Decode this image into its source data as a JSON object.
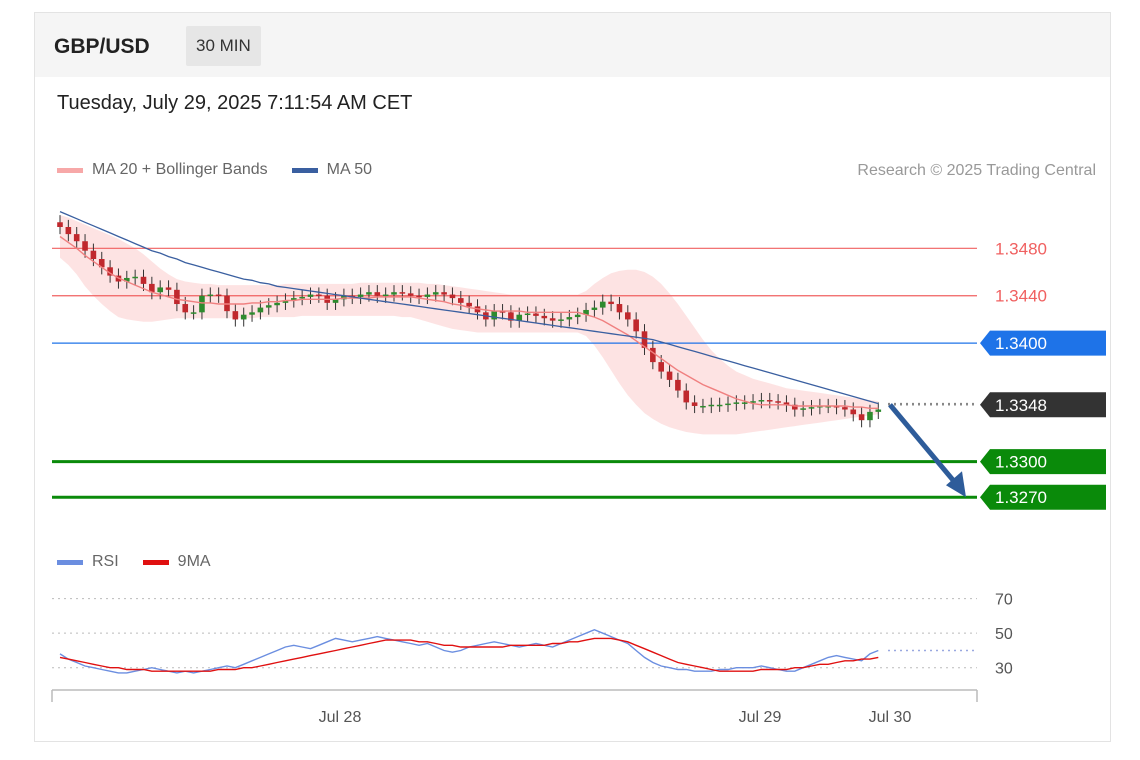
{
  "header": {
    "symbol": "GBP/USD",
    "timeframe": "30 MIN"
  },
  "datetime": "Tuesday, July 29, 2025 7:11:54 AM CET",
  "copyright": "Research © 2025 Trading Central",
  "legend_main": [
    {
      "label": "MA 20 + Bollinger Bands",
      "color": "#f08080"
    },
    {
      "label": "MA 50",
      "color": "#3a5fa0"
    }
  ],
  "legend_rsi": [
    {
      "label": "RSI",
      "color": "#6b8ee0"
    },
    {
      "label": "9MA",
      "color": "#e01010"
    }
  ],
  "colors": {
    "up_candle": "#2e8b2e",
    "down_candle": "#c0282d",
    "resistance": "#f06060",
    "pivot": "#1e73e8",
    "support": "#0a8a0a",
    "current": "#333333",
    "band_fill": "#fcdcdc",
    "arrow": "#2e5c9a",
    "ma50": "#3a5fa0",
    "ma20": "#f08080"
  },
  "chart_data": [
    {
      "type": "candlestick",
      "title": "GBP/USD 30 MIN",
      "x_tick_labels": [
        "Jul 28",
        "Jul 29",
        "Jul 30"
      ],
      "ylim": [
        1.3255,
        1.3525
      ],
      "levels": [
        {
          "value": 1.348,
          "label": "1.3480",
          "kind": "resistance"
        },
        {
          "value": 1.344,
          "label": "1.3440",
          "kind": "resistance"
        },
        {
          "value": 1.34,
          "label": "1.3400",
          "kind": "pivot"
        },
        {
          "value": 1.3348,
          "label": "1.3348",
          "kind": "current"
        },
        {
          "value": 1.33,
          "label": "1.3300",
          "kind": "support"
        },
        {
          "value": 1.327,
          "label": "1.3270",
          "kind": "support"
        }
      ],
      "close": [
        1.3498,
        1.3492,
        1.3486,
        1.3478,
        1.3471,
        1.3464,
        1.3457,
        1.3452,
        1.3455,
        1.3456,
        1.345,
        1.3443,
        1.3447,
        1.3445,
        1.3433,
        1.3426,
        1.3426,
        1.344,
        1.3441,
        1.344,
        1.3427,
        1.342,
        1.3424,
        1.3426,
        1.343,
        1.3432,
        1.3434,
        1.3436,
        1.3438,
        1.3439,
        1.3441,
        1.344,
        1.3434,
        1.3437,
        1.344,
        1.3439,
        1.3441,
        1.3443,
        1.344,
        1.3441,
        1.3443,
        1.3442,
        1.344,
        1.3439,
        1.3441,
        1.3443,
        1.3441,
        1.3438,
        1.3434,
        1.3431,
        1.3426,
        1.342,
        1.3427,
        1.3426,
        1.3419,
        1.3424,
        1.3425,
        1.3423,
        1.3421,
        1.3419,
        1.342,
        1.3422,
        1.3424,
        1.3428,
        1.343,
        1.3435,
        1.3433,
        1.3426,
        1.342,
        1.341,
        1.3396,
        1.3384,
        1.3376,
        1.3369,
        1.336,
        1.335,
        1.3347,
        1.3347,
        1.3348,
        1.3348,
        1.3349,
        1.335,
        1.335,
        1.3351,
        1.3352,
        1.3351,
        1.335,
        1.3348,
        1.3344,
        1.3345,
        1.3346,
        1.3347,
        1.3347,
        1.3346,
        1.3344,
        1.334,
        1.3335,
        1.3342,
        1.3344
      ],
      "ma20": [
        1.349,
        1.3485,
        1.348,
        1.3474,
        1.3469,
        1.3464,
        1.3459,
        1.3455,
        1.3452,
        1.3449,
        1.3446,
        1.3443,
        1.3441,
        1.3439,
        1.3437,
        1.3436,
        1.3435,
        1.3434,
        1.3434,
        1.3433,
        1.3433,
        1.3433,
        1.3433,
        1.3434,
        1.3434,
        1.3435,
        1.3435,
        1.3436,
        1.3436,
        1.3437,
        1.3437,
        1.3437,
        1.3437,
        1.3437,
        1.3438,
        1.3438,
        1.3438,
        1.3438,
        1.3439,
        1.3439,
        1.3439,
        1.3439,
        1.3439,
        1.3438,
        1.3437,
        1.3436,
        1.3435,
        1.3433,
        1.3432,
        1.343,
        1.3429,
        1.3428,
        1.3427,
        1.3427,
        1.3427,
        1.3427,
        1.3426,
        1.3426,
        1.3426,
        1.3426,
        1.3426,
        1.3426,
        1.3426,
        1.3424,
        1.3422,
        1.3419,
        1.3415,
        1.3411,
        1.3407,
        1.3402,
        1.3397,
        1.3392,
        1.3387,
        1.3382,
        1.3377,
        1.3373,
        1.3369,
        1.3365,
        1.3362,
        1.3359,
        1.3356,
        1.3353,
        1.3351,
        1.3349,
        1.3348,
        1.3348,
        1.3348,
        1.3348,
        1.3347,
        1.3347,
        1.3347,
        1.3347,
        1.3347,
        1.3347,
        1.3347,
        1.3346,
        1.3346,
        1.3345,
        1.3345
      ],
      "ma50": [
        1.3511,
        1.3508,
        1.3505,
        1.3502,
        1.3499,
        1.3496,
        1.3493,
        1.349,
        1.3487,
        1.3484,
        1.3481,
        1.3478,
        1.3476,
        1.3473,
        1.3471,
        1.3468,
        1.3466,
        1.3464,
        1.3462,
        1.346,
        1.3458,
        1.3456,
        1.3454,
        1.3453,
        1.3451,
        1.345,
        1.3448,
        1.3447,
        1.3446,
        1.3445,
        1.3444,
        1.3443,
        1.3442,
        1.3441,
        1.344,
        1.3439,
        1.3438,
        1.3437,
        1.3436,
        1.3435,
        1.3434,
        1.3433,
        1.3432,
        1.3431,
        1.343,
        1.3429,
        1.3428,
        1.3427,
        1.3426,
        1.3425,
        1.3424,
        1.3423,
        1.3422,
        1.3421,
        1.342,
        1.3419,
        1.3418,
        1.3417,
        1.3416,
        1.3415,
        1.3414,
        1.3413,
        1.3412,
        1.3411,
        1.341,
        1.3409,
        1.3408,
        1.3407,
        1.3406,
        1.3405,
        1.3404,
        1.3403,
        1.3401,
        1.3399,
        1.3397,
        1.3395,
        1.3393,
        1.3391,
        1.3389,
        1.3387,
        1.3385,
        1.3383,
        1.3381,
        1.3379,
        1.3377,
        1.3375,
        1.3373,
        1.3371,
        1.3369,
        1.3367,
        1.3365,
        1.3363,
        1.3361,
        1.3359,
        1.3357,
        1.3355,
        1.3353,
        1.3351,
        1.3349
      ],
      "bb_upper": [
        1.3508,
        1.3506,
        1.3503,
        1.35,
        1.3497,
        1.3494,
        1.3491,
        1.3488,
        1.3484,
        1.348,
        1.3475,
        1.3469,
        1.3463,
        1.3458,
        1.3454,
        1.3452,
        1.3451,
        1.345,
        1.345,
        1.3449,
        1.3449,
        1.3449,
        1.3449,
        1.3449,
        1.3449,
        1.3449,
        1.3449,
        1.345,
        1.345,
        1.345,
        1.345,
        1.345,
        1.345,
        1.345,
        1.345,
        1.345,
        1.3451,
        1.3451,
        1.3451,
        1.3451,
        1.3451,
        1.3451,
        1.3451,
        1.3451,
        1.345,
        1.345,
        1.3449,
        1.3448,
        1.3447,
        1.3446,
        1.3445,
        1.3444,
        1.3443,
        1.3442,
        1.3441,
        1.3441,
        1.3441,
        1.3441,
        1.3441,
        1.3441,
        1.3441,
        1.3441,
        1.3441,
        1.3444,
        1.345,
        1.3455,
        1.3459,
        1.3461,
        1.3462,
        1.3462,
        1.346,
        1.3456,
        1.345,
        1.3442,
        1.3433,
        1.3423,
        1.3413,
        1.3403,
        1.3394,
        1.3387,
        1.3381,
        1.3376,
        1.3373,
        1.337,
        1.3368,
        1.3366,
        1.3364,
        1.3362,
        1.3361,
        1.336,
        1.3359,
        1.3358,
        1.3357,
        1.3356,
        1.3355,
        1.3354,
        1.3353,
        1.3352,
        1.3351
      ],
      "bb_lower": [
        1.3472,
        1.3466,
        1.3458,
        1.3448,
        1.344,
        1.3433,
        1.3427,
        1.3422,
        1.342,
        1.3419,
        1.3418,
        1.3418,
        1.3419,
        1.342,
        1.3421,
        1.3421,
        1.3421,
        1.3421,
        1.3421,
        1.3421,
        1.3421,
        1.3421,
        1.3421,
        1.3421,
        1.3422,
        1.3422,
        1.3422,
        1.3422,
        1.3422,
        1.3423,
        1.3423,
        1.3423,
        1.3423,
        1.3423,
        1.3423,
        1.3423,
        1.3423,
        1.3423,
        1.3423,
        1.3423,
        1.3423,
        1.3422,
        1.3422,
        1.342,
        1.3418,
        1.3416,
        1.3414,
        1.3412,
        1.3411,
        1.341,
        1.3409,
        1.3409,
        1.3409,
        1.3409,
        1.3409,
        1.3409,
        1.3409,
        1.3409,
        1.3409,
        1.3409,
        1.3409,
        1.3409,
        1.3409,
        1.3406,
        1.3398,
        1.3388,
        1.3377,
        1.3366,
        1.3356,
        1.3348,
        1.3341,
        1.3336,
        1.3332,
        1.3329,
        1.3327,
        1.3325,
        1.3324,
        1.3323,
        1.3323,
        1.3323,
        1.3323,
        1.3323,
        1.3324,
        1.3325,
        1.3326,
        1.3327,
        1.3328,
        1.3329,
        1.333,
        1.3331,
        1.3332,
        1.3333,
        1.3334,
        1.3335,
        1.3336,
        1.3337,
        1.3338,
        1.3339,
        1.334
      ],
      "forecast_arrow": {
        "from": 1.3348,
        "to": 1.327
      }
    },
    {
      "type": "line",
      "title": "RSI",
      "ylim": [
        20,
        75
      ],
      "y_tick_labels": [
        "70",
        "50",
        "30"
      ],
      "y_ticks": [
        70,
        50,
        30
      ],
      "series": [
        {
          "name": "RSI",
          "values": [
            38,
            35,
            33,
            31,
            30,
            29,
            28,
            27,
            27,
            28,
            29,
            30,
            29,
            28,
            27,
            28,
            27,
            28,
            29,
            30,
            31,
            30,
            32,
            34,
            36,
            38,
            40,
            42,
            43,
            42,
            41,
            43,
            45,
            47,
            46,
            45,
            46,
            47,
            48,
            47,
            46,
            45,
            44,
            43,
            44,
            42,
            40,
            39,
            40,
            42,
            43,
            44,
            45,
            44,
            43,
            42,
            43,
            44,
            43,
            42,
            44,
            46,
            48,
            50,
            52,
            50,
            48,
            46,
            44,
            40,
            36,
            33,
            31,
            30,
            29,
            29,
            28,
            28,
            28,
            29,
            29,
            30,
            30,
            30,
            31,
            30,
            29,
            28,
            28,
            30,
            32,
            34,
            36,
            37,
            36,
            35,
            34,
            38,
            40
          ]
        },
        {
          "name": "9MA",
          "values": [
            36,
            35,
            34,
            33,
            32,
            31,
            30,
            30,
            29,
            29,
            29,
            28,
            28,
            28,
            28,
            28,
            28,
            28,
            28,
            29,
            29,
            29,
            30,
            30,
            31,
            32,
            33,
            34,
            35,
            36,
            37,
            38,
            39,
            40,
            41,
            42,
            43,
            44,
            45,
            46,
            46,
            46,
            46,
            45,
            45,
            44,
            43,
            43,
            42,
            42,
            42,
            42,
            42,
            42,
            43,
            43,
            43,
            43,
            43,
            44,
            44,
            45,
            45,
            46,
            47,
            47,
            47,
            46,
            45,
            43,
            41,
            39,
            37,
            35,
            33,
            32,
            31,
            30,
            29,
            28,
            28,
            28,
            28,
            28,
            29,
            29,
            29,
            29,
            30,
            30,
            31,
            32,
            32,
            33,
            34,
            34,
            35,
            35,
            36
          ]
        }
      ]
    }
  ]
}
